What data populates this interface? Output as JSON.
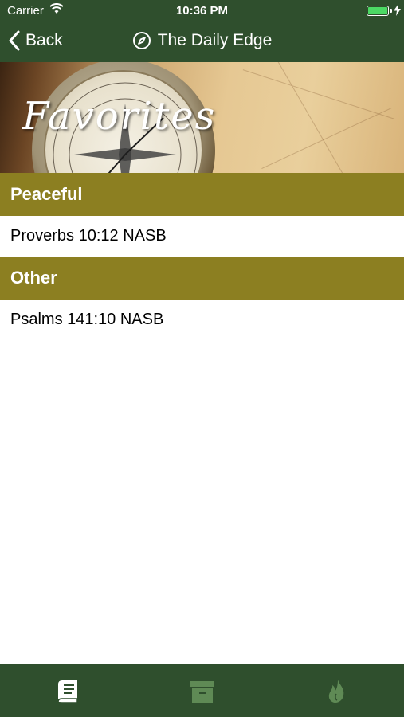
{
  "status_bar": {
    "carrier": "Carrier",
    "time": "10:36 PM",
    "battery_color": "#4cd964"
  },
  "nav": {
    "back_label": "Back",
    "title": "The Daily Edge",
    "title_icon": "compass-icon",
    "back_icon": "chevron-left-icon"
  },
  "banner": {
    "heading": "Favorites"
  },
  "sections": [
    {
      "title": "Peaceful",
      "items": [
        "Proverbs 10:12 NASB"
      ]
    },
    {
      "title": "Other",
      "items": [
        "Psalms 141:10 NASB"
      ]
    }
  ],
  "tab_bar": {
    "tabs": [
      {
        "icon": "book-icon",
        "active": true
      },
      {
        "icon": "archive-box-icon",
        "active": false
      },
      {
        "icon": "flame-icon",
        "active": false
      }
    ]
  },
  "colors": {
    "nav_bg": "#2f4f2d",
    "section_header_bg": "#8c7f21",
    "tab_active": "#ffffff",
    "tab_inactive": "#5f8a55"
  }
}
